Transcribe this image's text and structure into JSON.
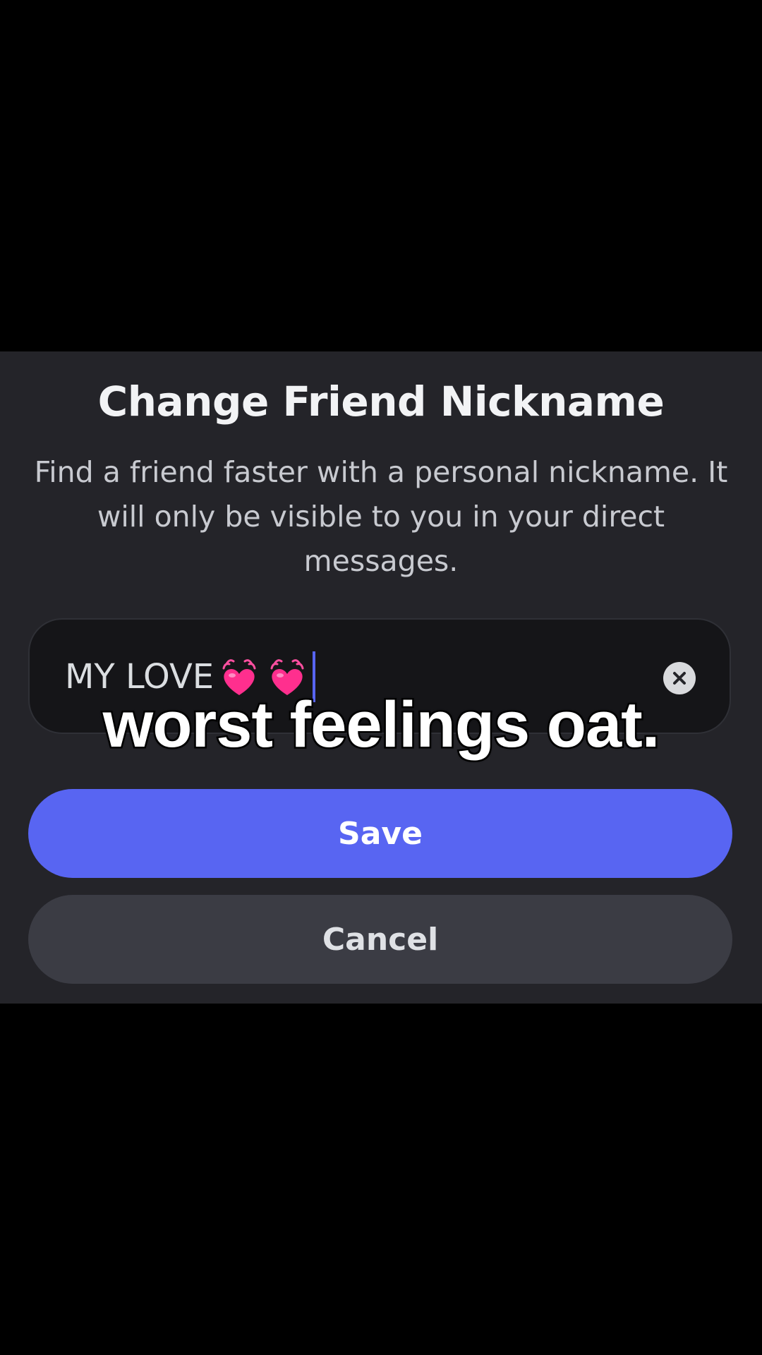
{
  "dialog": {
    "title": "Change Friend Nickname",
    "description": "Find a friend faster with a personal nickname. It will only be visible to you in your direct messages.",
    "nickname_input": {
      "value": "MY LOVE",
      "trailing_emoji": [
        "beating-heart-emoji",
        "beating-heart-emoji"
      ],
      "clear_icon": "close-circle-icon"
    },
    "save_label": "Save",
    "cancel_label": "Cancel"
  },
  "overlay_caption": "worst feelings oat.",
  "colors": {
    "background": "#000000",
    "dialog_bg": "#242429",
    "input_bg": "#151518",
    "accent": "#5865f2",
    "cancel_bg": "#3b3c44",
    "heart": "#ff2f8e"
  }
}
